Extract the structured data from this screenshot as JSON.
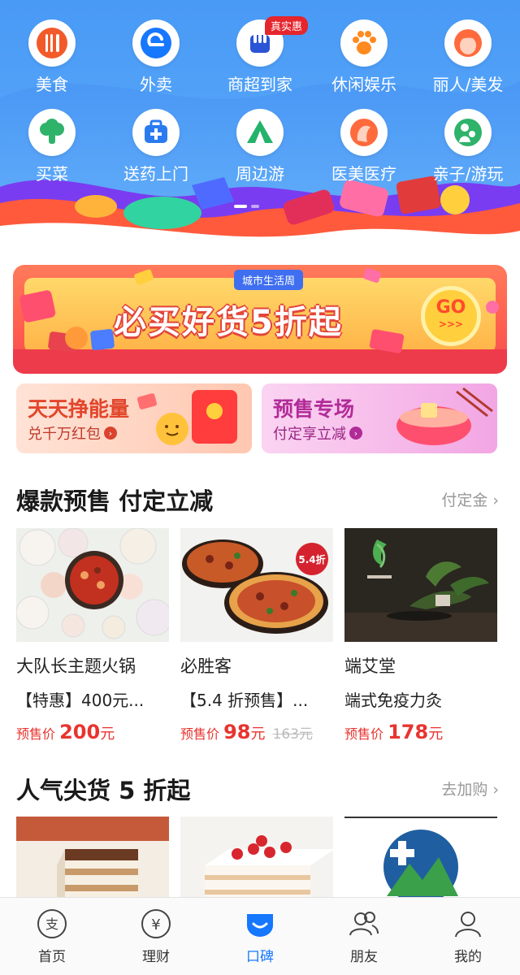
{
  "categories": {
    "row1": [
      {
        "label": "美食",
        "icon": "utensils-icon",
        "color": "#f25a2a"
      },
      {
        "label": "外卖",
        "icon": "takeout-e-icon",
        "color": "#1677ff"
      },
      {
        "label": "商超到家",
        "icon": "store-fist-icon",
        "color": "#2b54d6",
        "badge": "真实惠"
      },
      {
        "label": "休闲娱乐",
        "icon": "paw-icon",
        "color": "#ff8a1f"
      },
      {
        "label": "丽人/美发",
        "icon": "beauty-face-icon",
        "color": "#ff6a3d"
      }
    ],
    "row2": [
      {
        "label": "买菜",
        "icon": "broccoli-icon",
        "color": "#2fb36a"
      },
      {
        "label": "送药上门",
        "icon": "medicine-kit-icon",
        "color": "#2a7bf0"
      },
      {
        "label": "周边游",
        "icon": "tent-icon",
        "color": "#25b36b"
      },
      {
        "label": "医美医疗",
        "icon": "medical-face-icon",
        "color": "#ff6a3d"
      },
      {
        "label": "亲子/游玩",
        "icon": "parent-child-icon",
        "color": "#2fb36a"
      }
    ]
  },
  "promo": {
    "tag": "城市生活周",
    "headline": "必买好货5折起",
    "go": "GO",
    "go_sub": ">>>"
  },
  "sub_cards": [
    {
      "title": "天天挣能量",
      "subtitle": "兑千万红包"
    },
    {
      "title": "预售专场",
      "subtitle": "付定享立减"
    }
  ],
  "presale": {
    "title": "爆款预售 付定立减",
    "more": "付定金",
    "items": [
      {
        "name": "大队长主题火锅",
        "desc": "【特惠】400元...",
        "price_label": "预售价",
        "price": "200",
        "unit": "元",
        "original": ""
      },
      {
        "name": "必胜客",
        "desc": "【5.4 折预售】...",
        "price_label": "预售价",
        "price": "98",
        "unit": "元",
        "original": "163元",
        "img_badge": "5.4折"
      },
      {
        "name": "端艾堂",
        "desc": "端式免疫力灸",
        "price_label": "预售价",
        "price": "178",
        "unit": "元",
        "original": ""
      }
    ]
  },
  "popular": {
    "title": "人气尖货 5 折起",
    "more": "去加购"
  },
  "tabbar": [
    {
      "label": "首页",
      "icon": "alipay-home-icon",
      "active": false
    },
    {
      "label": "理财",
      "icon": "yuan-coin-icon",
      "active": false
    },
    {
      "label": "口碑",
      "icon": "koubei-smile-icon",
      "active": true
    },
    {
      "label": "朋友",
      "icon": "friends-icon",
      "active": false
    },
    {
      "label": "我的",
      "icon": "profile-icon",
      "active": false
    }
  ]
}
